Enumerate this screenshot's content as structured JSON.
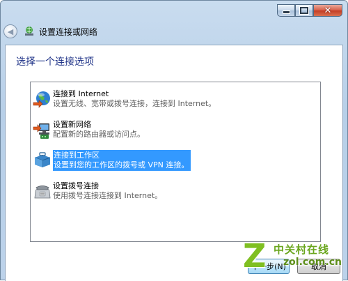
{
  "window": {
    "close_glyph": "✕"
  },
  "nav": {
    "back_glyph": "◀",
    "title": "设置连接或网络"
  },
  "main": {
    "heading": "选择一个连接选项",
    "options": [
      {
        "title": "连接到 Internet",
        "description": "设置无线、宽带或拨号连接，连接到 Internet。",
        "icon": "globe-connect-icon",
        "selected": false
      },
      {
        "title": "设置新网络",
        "description": "配置新的路由器或访问点。",
        "icon": "network-router-icon",
        "selected": false
      },
      {
        "title": "连接到工作区",
        "description": "设置到您的工作区的拨号或 VPN 连接。",
        "icon": "workplace-briefcase-icon",
        "selected": true
      },
      {
        "title": "设置拨号连接",
        "description": "使用拨号连接连接到 Internet。",
        "icon": "dialup-phone-icon",
        "selected": false
      }
    ]
  },
  "buttons": {
    "next_label": "下一步(N)",
    "cancel_label": "取消"
  },
  "watermark": {
    "letter": "Z",
    "name": "中关村在线",
    "url": "zol.com.cn"
  }
}
